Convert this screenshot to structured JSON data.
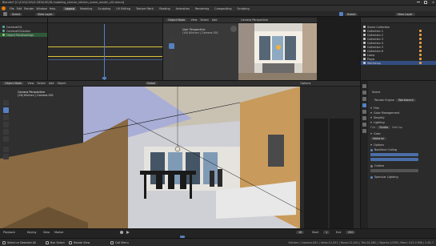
{
  "titlebar": {
    "title": "Blender* [C:\\C10\\C10\\01-DEV\\UG\\3D-modeling_interior_kitchen_scene_render_v01.blend]"
  },
  "menubar": {
    "menus": [
      "File",
      "Edit",
      "Render",
      "Window",
      "Help"
    ],
    "workspaces": [
      "Layout",
      "Modeling",
      "Sculpting",
      "UV Editing",
      "Texture Paint",
      "Shading",
      "Animation",
      "Rendering",
      "Compositing",
      "Scripting"
    ],
    "active_workspace": "Layout"
  },
  "scenebar": {
    "scene": "Scene",
    "view_layer": "View Layer"
  },
  "outliner": {
    "items": [
      {
        "label": "Camera001"
      },
      {
        "label": "Camera001Action"
      },
      {
        "label": "Object ParallaxAlign"
      }
    ]
  },
  "top_center_viewport": {
    "mode": "Object Mode",
    "view": "View",
    "select": "Select",
    "add": "Add",
    "object": "Object",
    "info1": "User Perspective",
    "info2": "(16) Kitchen | Camera.001"
  },
  "camera_view": {
    "label": "Camera Perspective"
  },
  "main_viewport": {
    "mode": "Object Mode",
    "view": "View",
    "select": "Select",
    "add": "Add",
    "object": "Object",
    "info1": "Camera Perspective",
    "info2": "(16) Kitchen | Camera.001",
    "shading": "Global",
    "options": "Options"
  },
  "scene_collection": {
    "title": "Scene Collection",
    "items": [
      "Collection 1",
      "Collection 2",
      "Collection 3",
      "Collection 4",
      "Collection 5",
      "Collection 6",
      "Lamp",
      "Props",
      "Workshop"
    ]
  },
  "properties": {
    "title": "Scene",
    "render_engine_label": "Render Engine",
    "render_engine": "Workbench",
    "sections": [
      "Film",
      "Color Management",
      "Simplify",
      "Lighting",
      "Color",
      "Options"
    ],
    "subsections": [
      "Backface Culling",
      "Outline",
      "Specular Lighting"
    ],
    "lighting_value": "Studio",
    "color_value": "Material",
    "lighting_options": [
      "Flat",
      "MatCap"
    ]
  },
  "timeline": {
    "playback": "Playback",
    "keying": "Keying",
    "view": "View",
    "marker": "Marker",
    "frame": "16",
    "start_label": "Start",
    "start": "1",
    "end_label": "End",
    "end": "250"
  },
  "statusbar": {
    "left": "Select or Deselect All",
    "mid1": "Box Select",
    "mid2": "Rotate View",
    "mid3": "Call Menu",
    "right": "Kitchen | Camera.001 | Verts:12,531 | Faces:12,041 | Tris:24,082 | Objects:1/256 | Mem: 412.0 MiB | 2.82.7"
  }
}
